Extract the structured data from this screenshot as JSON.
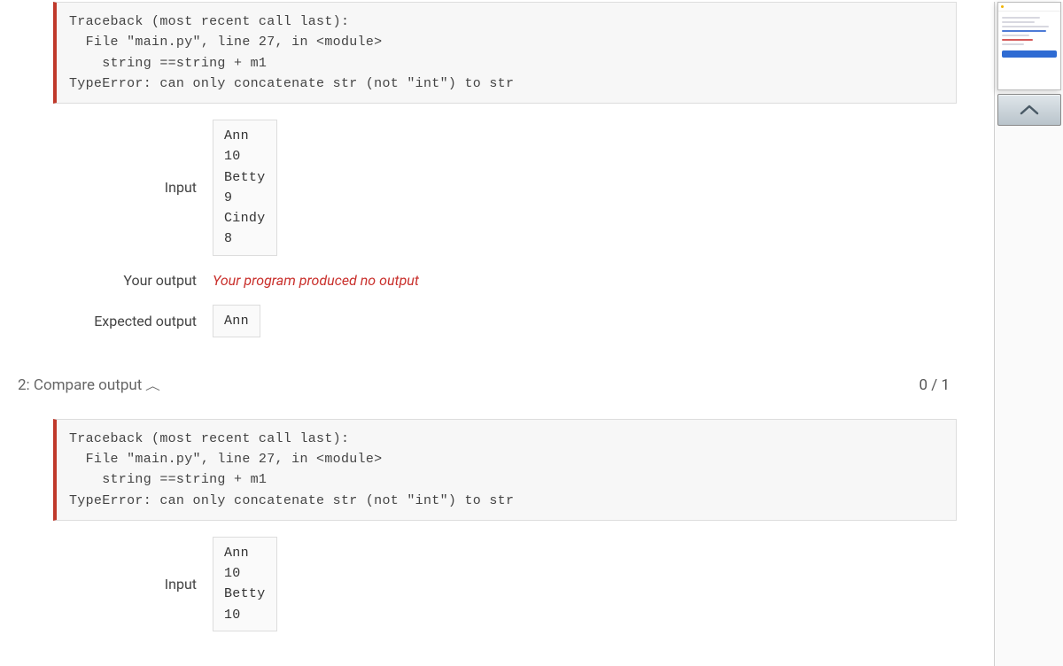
{
  "test1": {
    "traceback": "Traceback (most recent call last):\n  File \"main.py\", line 27, in <module>\n    string ==string + m1\nTypeError: can only concatenate str (not \"int\") to str",
    "input_label": "Input",
    "input_data": "Ann\n10\nBetty\n9\nCindy\n8",
    "your_output_label": "Your output",
    "your_output_msg": "Your program produced no output",
    "expected_label": "Expected output",
    "expected_data": "Ann"
  },
  "section2": {
    "title": "2: Compare output",
    "score": "0 / 1"
  },
  "test2": {
    "traceback": "Traceback (most recent call last):\n  File \"main.py\", line 27, in <module>\n    string ==string + m1\nTypeError: can only concatenate str (not \"int\") to str",
    "input_label": "Input",
    "input_data": "Ann\n10\nBetty\n10"
  }
}
